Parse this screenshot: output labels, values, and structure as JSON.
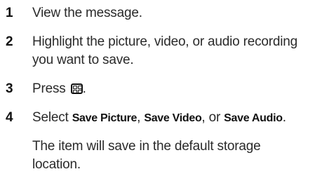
{
  "steps": [
    {
      "number": "1",
      "text": "View the message."
    },
    {
      "number": "2",
      "text": "Highlight the picture, video, or audio recording you want to save."
    },
    {
      "number": "3",
      "text_before": "Press ",
      "icon": "menu-key-icon",
      "text_after": "."
    },
    {
      "number": "4",
      "text_select": "Select ",
      "option1": "Save Picture",
      "sep1": ", ",
      "option2": "Save Video",
      "sep2": ", or ",
      "option3": "Save Audio",
      "text_end": ".",
      "note": "The item will save in the default storage location."
    }
  ]
}
